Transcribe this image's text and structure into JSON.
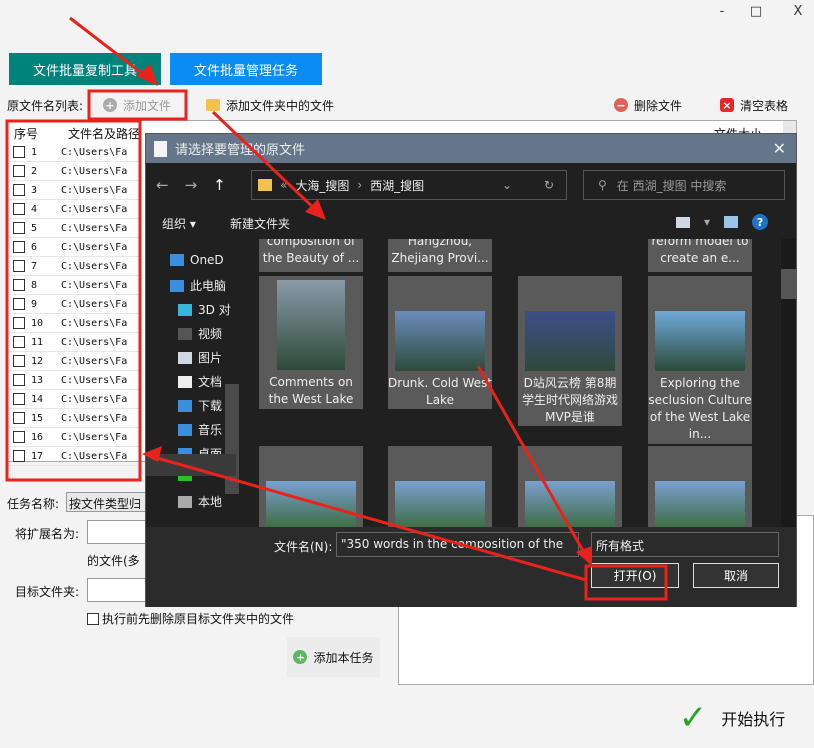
{
  "window": {
    "minimize": "-",
    "maximize": "□",
    "close": "X"
  },
  "tabs": [
    {
      "label": "文件批量复制工具",
      "color": "#00837a"
    },
    {
      "label": "文件批量管理任务",
      "color": "#0a8cf5"
    }
  ],
  "toolbar": {
    "list_label": "原文件名列表:",
    "add_file": "添加文件",
    "add_folder": "添加文件夹中的文件",
    "delete_file": "删除文件",
    "clear_table": "清空表格"
  },
  "table": {
    "headers": [
      "序号",
      "文件名及路径",
      "文件大小"
    ],
    "rows": [
      {
        "n": "1",
        "path": "C:\\Users\\Fa"
      },
      {
        "n": "2",
        "path": "C:\\Users\\Fa"
      },
      {
        "n": "3",
        "path": "C:\\Users\\Fa"
      },
      {
        "n": "4",
        "path": "C:\\Users\\Fa"
      },
      {
        "n": "5",
        "path": "C:\\Users\\Fa"
      },
      {
        "n": "6",
        "path": "C:\\Users\\Fa"
      },
      {
        "n": "7",
        "path": "C:\\Users\\Fa"
      },
      {
        "n": "8",
        "path": "C:\\Users\\Fa"
      },
      {
        "n": "9",
        "path": "C:\\Users\\Fa"
      },
      {
        "n": "10",
        "path": "C:\\Users\\Fa"
      },
      {
        "n": "11",
        "path": "C:\\Users\\Fa"
      },
      {
        "n": "12",
        "path": "C:\\Users\\Fa"
      },
      {
        "n": "13",
        "path": "C:\\Users\\Fa"
      },
      {
        "n": "14",
        "path": "C:\\Users\\Fa"
      },
      {
        "n": "15",
        "path": "C:\\Users\\Fa"
      },
      {
        "n": "16",
        "path": "C:\\Users\\Fa"
      },
      {
        "n": "17",
        "path": "C:\\Users\\Fa"
      }
    ]
  },
  "task": {
    "name_label": "任务名称:",
    "name_value": "按文件类型归",
    "ext_label": "将扩展名为:",
    "ext_suffix": "的文件(多",
    "target_label": "目标文件夹:",
    "delete_first": "执行前先删除原目标文件夹中的文件",
    "add_task": "添加本任务",
    "start": "开始执行"
  },
  "dialog": {
    "title": "请选择要管理的原文件",
    "breadcrumb": [
      "大海_搜图",
      "西湖_搜图"
    ],
    "search_placeholder": "在 西湖_搜图 中搜索",
    "organize": "组织",
    "new_folder": "新建文件夹",
    "sidebar": [
      "OneD",
      "此电脑",
      "3D 对",
      "视频",
      "图片",
      "文档",
      "下载",
      "音乐",
      "桌面",
      "",
      "本地"
    ],
    "tiles_row1": [
      "composition of the Beauty of ...",
      "Hangzhou, Zhejiang Provi...",
      "",
      "reform model to create an e..."
    ],
    "tiles_row2": [
      "Comments on the West Lake",
      "Drunk. Cold West Lake",
      "D站风云榜 第8期 学生时代网络游戏MVP是谁",
      "Exploring the seclusion Culture of the West Lake in..."
    ],
    "filename_label": "文件名(N):",
    "filename_value": "\"350 words in the composition of the",
    "filetype": "所有格式",
    "open": "打开(O)",
    "cancel": "取消"
  },
  "colors": {
    "annotation": "#e8231c",
    "dialog_title": "#65758a"
  }
}
